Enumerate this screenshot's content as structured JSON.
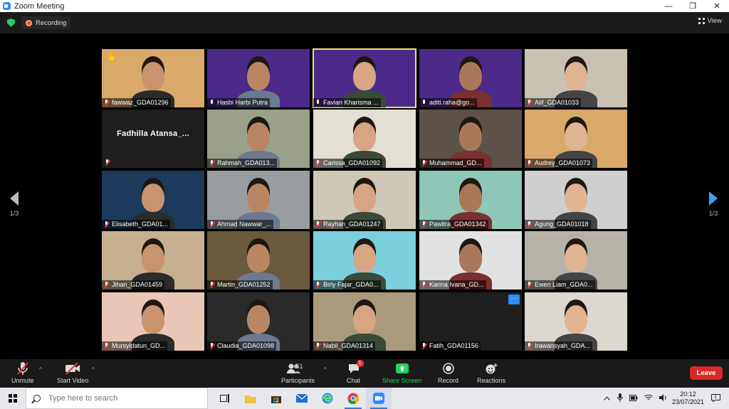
{
  "window": {
    "title": "Zoom Meeting",
    "minimize": "—",
    "maximize": "❐",
    "close": "✕"
  },
  "topbar": {
    "recording_label": "Recording",
    "view_label": "View"
  },
  "pager": {
    "left_page": "1/3",
    "right_page": "1/3"
  },
  "participants": [
    {
      "name": "fawwaz_GDA01296",
      "muted": true,
      "hand_raised": true,
      "bg": "#d9a96a"
    },
    {
      "name": "Hasbi Harbi Putra",
      "muted": false,
      "bg": "#4b2a8a"
    },
    {
      "name": "Favian Kharisma ...",
      "muted": false,
      "bg": "#4b2a8a",
      "active": true
    },
    {
      "name": "aditi.raha@go...",
      "muted": false,
      "bg": "#4b2a8a"
    },
    {
      "name": "Alif_GDA01033",
      "muted": true,
      "bg": "#c9c2b3"
    },
    {
      "name": "",
      "muted": true,
      "display_name": "Fadhilla  Atansa_...",
      "bg": "#1e1e1e"
    },
    {
      "name": "Rahmah_GDA013...",
      "muted": true,
      "bg": "#9aa08a"
    },
    {
      "name": "Carissa_GDA01092",
      "muted": true,
      "bg": "#e4dfd5"
    },
    {
      "name": "Muhammad_GD...",
      "muted": true,
      "bg": "#5c524a"
    },
    {
      "name": "Audrey_GDA01073",
      "muted": true,
      "bg": "#d9a96a"
    },
    {
      "name": "Elisabeth_GDA01...",
      "muted": true,
      "bg": "#1b3a5c"
    },
    {
      "name": "Ahmad Nawwar_...",
      "muted": true,
      "bg": "#9a9da0"
    },
    {
      "name": "Rayhan_GDA01247",
      "muted": true,
      "bg": "#cfc8b8"
    },
    {
      "name": "Pawitra_GDA01342",
      "muted": true,
      "bg": "#8ec7b7"
    },
    {
      "name": "Agung_GDA01018",
      "muted": true,
      "bg": "#cfcfcf"
    },
    {
      "name": "Jihan_GDA01459",
      "muted": true,
      "bg": "#c7b090"
    },
    {
      "name": "Martin_GDA01252",
      "muted": true,
      "bg": "#6c5a3e"
    },
    {
      "name": "Birly Fajar_GDA0...",
      "muted": true,
      "bg": "#7ccfdc"
    },
    {
      "name": "Karina Ivana_GD...",
      "muted": true,
      "bg": "#e2e2e2"
    },
    {
      "name": "Ewen Liam_GDA0...",
      "muted": true,
      "bg": "#b7b2a8"
    },
    {
      "name": "Mursyidatun_GD...",
      "muted": true,
      "bg": "#e9c6b6"
    },
    {
      "name": "Claudia_GDA01098",
      "muted": true,
      "bg": "#2a2a2a"
    },
    {
      "name": "Nabil_GDA01314",
      "muted": true,
      "bg": "#a99a7c"
    },
    {
      "name": "Fatih_GDA01156",
      "muted": true,
      "bg": "#1e1e1e",
      "no_video": true,
      "more_button": "···"
    },
    {
      "name": "Irawansyah_GDA...",
      "muted": true,
      "bg": "#ddd8cf"
    }
  ],
  "toolbar": {
    "unmute": "Unmute",
    "start_video": "Start Video",
    "participants": "Participants",
    "participants_count": "51",
    "chat": "Chat",
    "chat_badge": "1",
    "share_screen": "Share Screen",
    "record": "Record",
    "reactions": "Reactions",
    "leave": "Leave",
    "caret": "^"
  },
  "taskbar": {
    "search_placeholder": "Type here to search",
    "time": "20:12",
    "date": "23/07/2021",
    "notification_count": "1"
  },
  "colors": {
    "accent": "#2d8cff",
    "share_green": "#23d160",
    "leave_red": "#d72a2a",
    "active_border": "#e9e26b"
  }
}
